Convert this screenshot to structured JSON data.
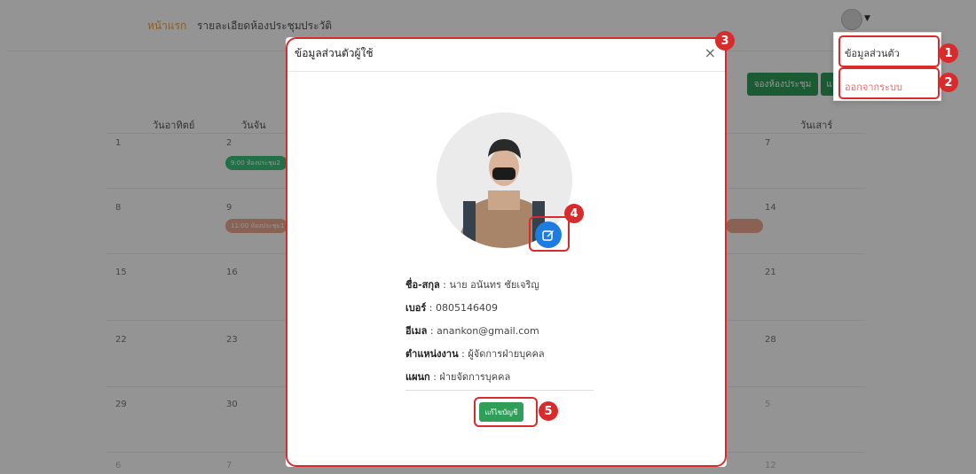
{
  "nav": {
    "home": "หน้าแรก",
    "room_details": "รายละเอียดห้องประชุม",
    "history": "ประวัติ"
  },
  "dropdown": {
    "profile": "ข้อมูลส่วนตัว",
    "logout": "ออกจากระบบ"
  },
  "actions": {
    "book_room": "จองห้องประชุม",
    "notify": "แจ้ง"
  },
  "calendar": {
    "headers": [
      "วันอาทิตย์",
      "วันจัน",
      "วันเสาร์"
    ],
    "rows": [
      [
        "1",
        "2",
        "7"
      ],
      [
        "8",
        "9",
        "14"
      ],
      [
        "15",
        "16",
        "21"
      ],
      [
        "22",
        "23",
        "28"
      ],
      [
        "29",
        "30",
        "5"
      ],
      [
        "6",
        "7",
        "12"
      ]
    ],
    "events": [
      "9:00 ห้องประชุม2",
      "11:00 ห้องประชุม1"
    ]
  },
  "modal": {
    "title": "ข้อมูลส่วนตัวผู้ใช้",
    "close": "×",
    "fields": [
      {
        "label": "ชื่อ-สกุล",
        "value": "นาย อนันทร ชัยเจริญ"
      },
      {
        "label": "เบอร์",
        "value": "0805146409"
      },
      {
        "label": "อีเมล",
        "value": "anankon@gmail.com"
      },
      {
        "label": "ตำแหน่งงาน",
        "value": "ผู้จัดการฝ่ายบุคคล"
      },
      {
        "label": "แผนก",
        "value": "ฝ่ายจัดการบุคคล"
      }
    ],
    "edit_account": "แก้ไขบัญชี"
  },
  "annotations": [
    "1",
    "2",
    "3",
    "4",
    "5"
  ],
  "colors": {
    "accent_green": "#2e9e58",
    "highlight_red": "#d92b2b",
    "edit_blue": "#1e7be0",
    "nav_active": "#e8a24a"
  }
}
